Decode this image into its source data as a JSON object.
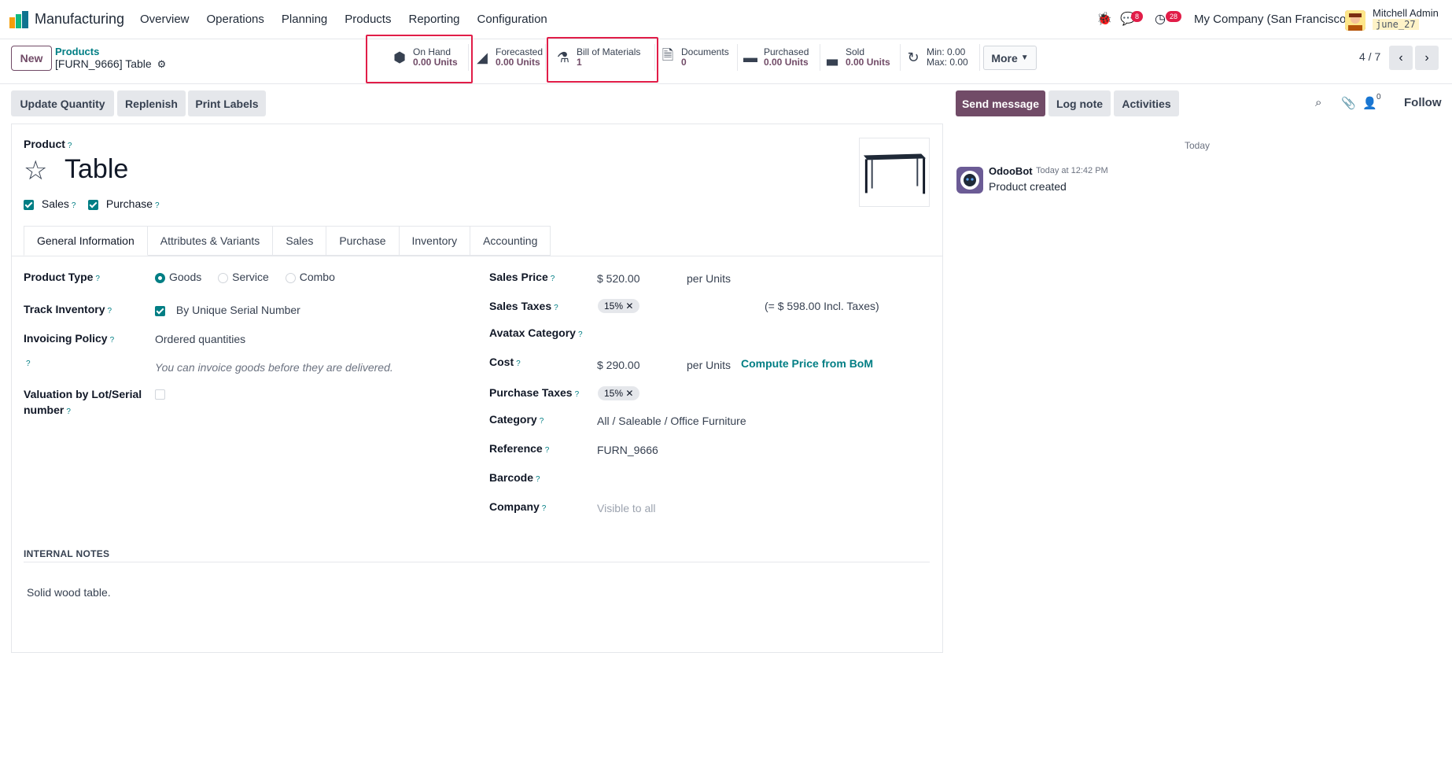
{
  "navbar": {
    "app_name": "Manufacturing",
    "menu": [
      "Overview",
      "Operations",
      "Planning",
      "Products",
      "Reporting",
      "Configuration"
    ],
    "messages_badge": "8",
    "activities_badge": "28",
    "company": "My Company (San Francisco)",
    "user_name": "Mitchell Admin",
    "db_name": "june_27"
  },
  "control": {
    "new_label": "New",
    "breadcrumb_parent": "Products",
    "breadcrumb_current": "[FURN_9666] Table",
    "pager": "4 / 7"
  },
  "smart_buttons": [
    {
      "icon": "cubes-icon",
      "title": "On Hand",
      "value": "0.00 Units"
    },
    {
      "icon": "area-chart-icon",
      "title": "Forecasted",
      "value": "0.00 Units"
    },
    {
      "icon": "flask-icon",
      "title": "Bill of Materials",
      "value": "1"
    },
    {
      "icon": "document-icon",
      "title": "Documents",
      "value": "0"
    },
    {
      "icon": "credit-card-icon",
      "title": "Purchased",
      "value": "0.00 Units"
    },
    {
      "icon": "signal-icon",
      "title": "Sold",
      "value": "0.00 Units"
    },
    {
      "icon": "refresh-icon",
      "title": "Min: 0.00",
      "value": "Max: 0.00"
    }
  ],
  "more_label": "More",
  "actions": {
    "update_quantity": "Update Quantity",
    "replenish": "Replenish",
    "print_labels": "Print Labels"
  },
  "chatter": {
    "send_message": "Send message",
    "log_note": "Log note",
    "activities": "Activities",
    "followers_count": "0",
    "follow": "Follow",
    "today": "Today",
    "author": "OdooBot",
    "time": "Today at 12:42 PM",
    "message": "Product created"
  },
  "form": {
    "product_label": "Product",
    "name": "Table",
    "sales_label": "Sales",
    "purchase_label": "Purchase",
    "tabs": [
      "General Information",
      "Attributes & Variants",
      "Sales",
      "Purchase",
      "Inventory",
      "Accounting"
    ],
    "product_type_label": "Product Type",
    "product_type_options": [
      "Goods",
      "Service",
      "Combo"
    ],
    "track_inventory_label": "Track Inventory",
    "track_inventory_value": "By Unique Serial Number",
    "invoicing_policy_label": "Invoicing Policy",
    "invoicing_policy_value": "Ordered quantities",
    "invoicing_hint": "You can invoice goods before they are delivered.",
    "valuation_label_1": "Valuation by Lot/Serial",
    "valuation_label_2": "number",
    "sales_price_label": "Sales Price",
    "sales_price_value": "$ 520.00",
    "per_units": "per Units",
    "sales_taxes_label": "Sales Taxes",
    "sales_taxes_tag": "15%",
    "incl_taxes": "(= $ 598.00 Incl. Taxes)",
    "avatax_label": "Avatax Category",
    "cost_label": "Cost",
    "cost_value": "$ 290.00",
    "compute_bom": "Compute Price from BoM",
    "purchase_taxes_label": "Purchase Taxes",
    "purchase_taxes_tag": "15%",
    "category_label": "Category",
    "category_value": "All / Saleable / Office Furniture",
    "reference_label": "Reference",
    "reference_value": "FURN_9666",
    "barcode_label": "Barcode",
    "company_label": "Company",
    "company_placeholder": "Visible to all",
    "notes_heading": "INTERNAL NOTES",
    "notes_value": "Solid wood table."
  },
  "colors": {
    "brand": "#714b67",
    "accent": "#017e84",
    "highlight": "#e11d48"
  }
}
